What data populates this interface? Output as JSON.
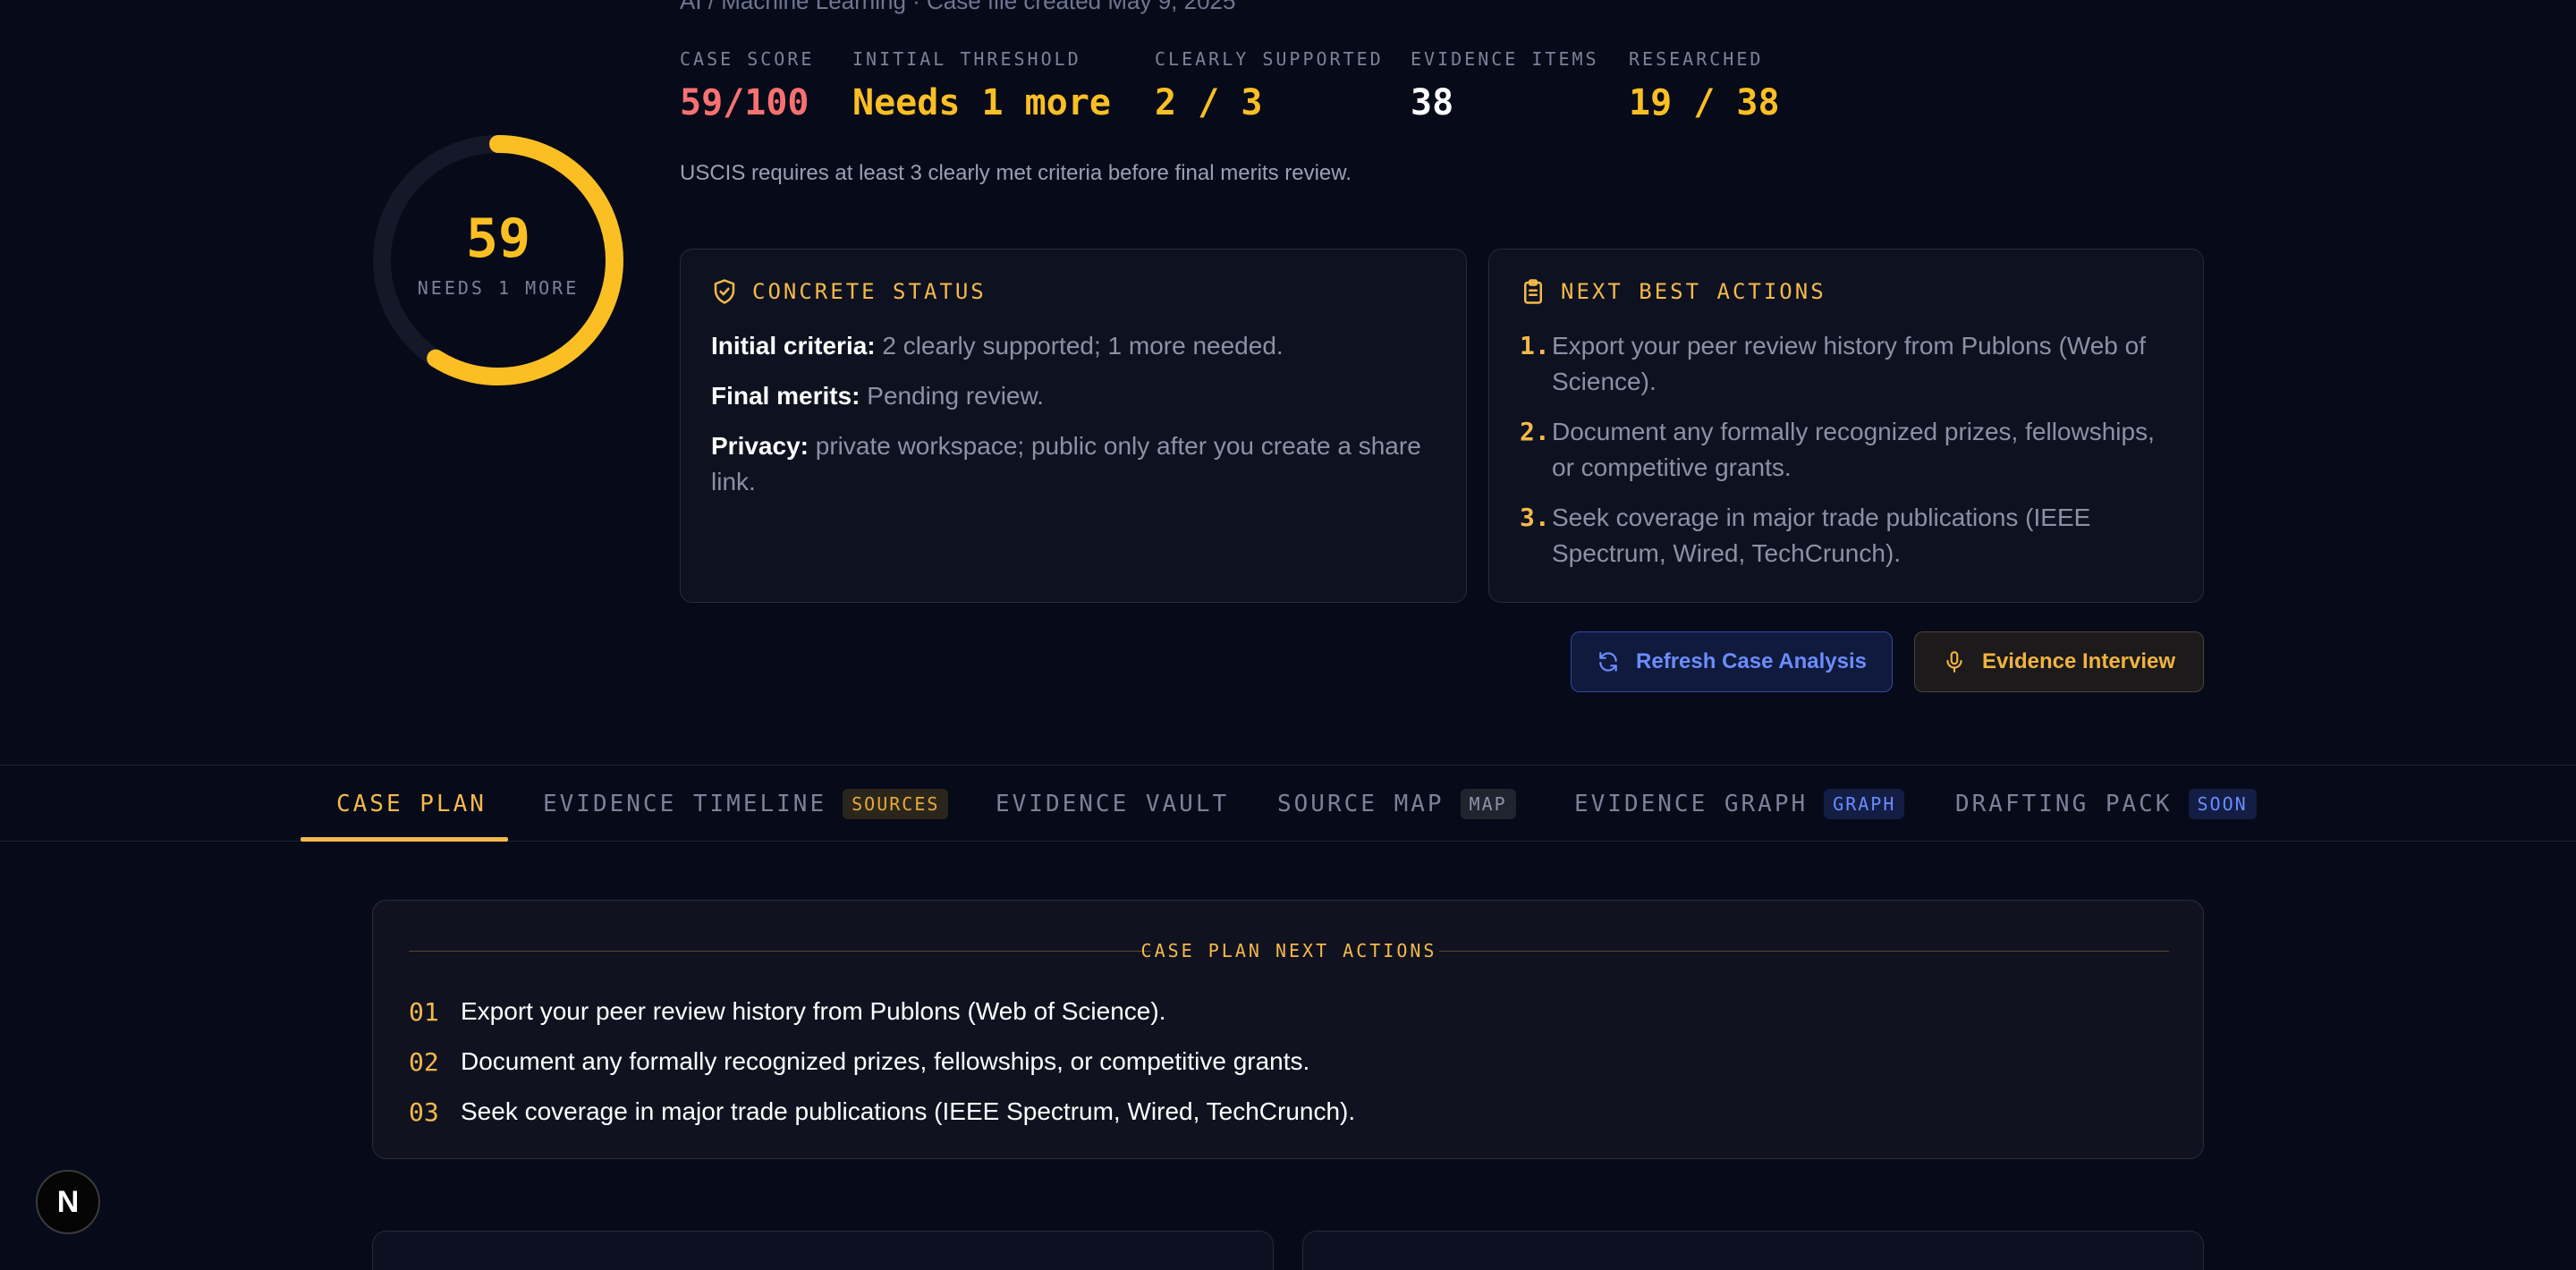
{
  "header": {
    "subtitle": "AI / Machine Learning · Case file created May 9, 2025"
  },
  "score_ring": {
    "value": "59",
    "label": "NEEDS 1 MORE",
    "progress": 0.59,
    "color": "#fbbf24"
  },
  "stats": [
    {
      "label": "CASE SCORE",
      "value": "59/100",
      "color": "#f87171"
    },
    {
      "label": "INITIAL THRESHOLD",
      "value": "Needs 1 more",
      "color": "#fbbf24"
    },
    {
      "label": "CLEARLY SUPPORTED",
      "value": "2 / 3",
      "color": "#fbbf24"
    },
    {
      "label": "EVIDENCE ITEMS",
      "value": "38",
      "color": "#ffffff"
    },
    {
      "label": "RESEARCHED",
      "value": "19 / 38",
      "color": "#fbbf24"
    }
  ],
  "note": "USCIS requires at least 3 clearly met criteria before final merits review.",
  "concrete_status": {
    "title": "CONCRETE STATUS",
    "icon": "shield-check-icon",
    "lines": [
      {
        "label": "Initial criteria:",
        "text": " 2 clearly supported; 1 more needed."
      },
      {
        "label": "Final merits:",
        "text": " Pending review."
      },
      {
        "label": "Privacy:",
        "text": " private workspace; public only after you create a share link."
      }
    ]
  },
  "next_best_actions": {
    "title": "NEXT BEST ACTIONS",
    "icon": "clipboard-list-icon",
    "items": [
      {
        "num": "1.",
        "text": "Export your peer review history from Publons (Web of Science)."
      },
      {
        "num": "2.",
        "text": "Document any formally recognized prizes, fellowships, or competitive grants."
      },
      {
        "num": "3.",
        "text": "Seek coverage in major trade publications (IEEE Spectrum, Wired, TechCrunch)."
      }
    ]
  },
  "buttons": {
    "refresh": {
      "label": "Refresh Case Analysis",
      "icon": "refresh-icon"
    },
    "interview": {
      "label": "Evidence Interview",
      "icon": "microphone-icon"
    }
  },
  "tabs": [
    {
      "label": "CASE PLAN",
      "badge": "",
      "active": true
    },
    {
      "label": "EVIDENCE TIMELINE",
      "badge": "SOURCES"
    },
    {
      "label": "EVIDENCE VAULT",
      "badge": ""
    },
    {
      "label": "SOURCE MAP",
      "badge": "MAP"
    },
    {
      "label": "EVIDENCE GRAPH",
      "badge": "GRAPH"
    },
    {
      "label": "DRAFTING PACK",
      "badge": "SOON"
    }
  ],
  "case_plan": {
    "title": "CASE PLAN NEXT ACTIONS",
    "items": [
      {
        "num": "01",
        "text": "Export your peer review history from Publons (Web of Science)."
      },
      {
        "num": "02",
        "text": "Document any formally recognized prizes, fellowships, or competitive grants."
      },
      {
        "num": "03",
        "text": "Seek coverage in major trade publications (IEEE Spectrum, Wired, TechCrunch)."
      }
    ]
  },
  "floating_badge": {
    "label": "N"
  }
}
